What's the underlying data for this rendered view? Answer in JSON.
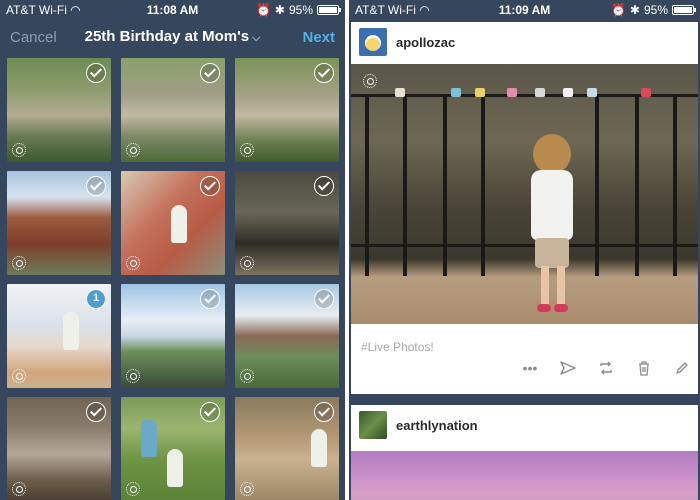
{
  "left_screen": {
    "status": {
      "carrier": "AT&T Wi-Fi",
      "time": "11:08 AM",
      "battery": "95%"
    },
    "nav": {
      "cancel": "Cancel",
      "title": "25th Birthday at Mom's",
      "next": "Next"
    },
    "photos": [
      {
        "state": "check"
      },
      {
        "state": "check"
      },
      {
        "state": "check"
      },
      {
        "state": "check"
      },
      {
        "state": "check"
      },
      {
        "state": "check"
      },
      {
        "state": "selected",
        "number": "1"
      },
      {
        "state": "check"
      },
      {
        "state": "check"
      },
      {
        "state": "check"
      },
      {
        "state": "check"
      },
      {
        "state": "check"
      }
    ]
  },
  "right_screen": {
    "status": {
      "carrier": "AT&T Wi-Fi",
      "time": "11:09 AM",
      "battery": "95%"
    },
    "post1": {
      "username": "apollozac",
      "tags": "#Live Photos!",
      "actions": [
        "more-icon",
        "share-icon",
        "reblog-icon",
        "delete-icon",
        "edit-icon"
      ]
    },
    "post2": {
      "username": "earthlynation"
    }
  },
  "colors": {
    "background": "#36465d",
    "next_accent": "#4fb2e8",
    "selected_badge": "#4d9fd2"
  }
}
